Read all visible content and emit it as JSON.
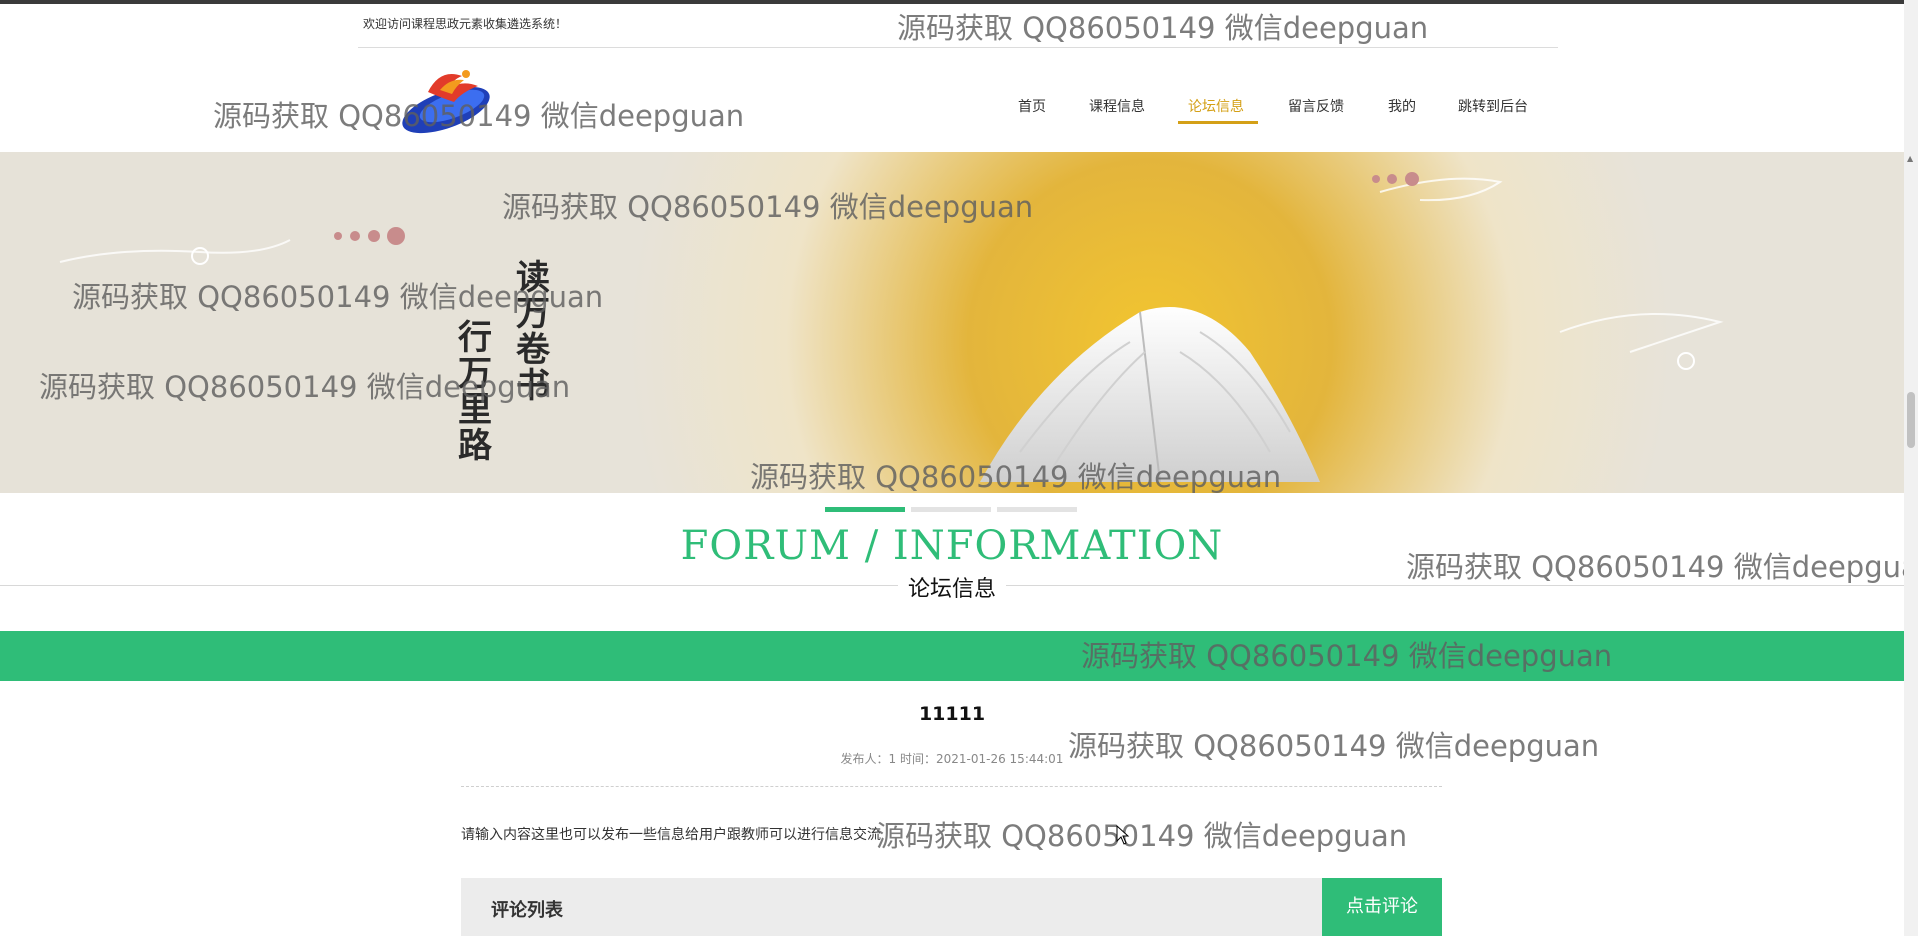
{
  "header": {
    "welcome_text": "欢迎访问课程思政元素收集遴选系统！"
  },
  "nav": {
    "items": [
      {
        "label": "首页",
        "active": false
      },
      {
        "label": "课程信息",
        "active": false
      },
      {
        "label": "论坛信息",
        "active": true
      },
      {
        "label": "留言反馈",
        "active": false
      },
      {
        "label": "我的",
        "active": false
      },
      {
        "label": "跳转到后台",
        "active": false
      }
    ]
  },
  "banner": {
    "calligraphy_right": "读万卷书",
    "calligraphy_left": "行万里路",
    "slide_count": 3,
    "active_slide": 1
  },
  "section": {
    "title_en": "FORUM / INFORMATION",
    "title_cn": "论坛信息"
  },
  "article": {
    "title": "11111",
    "meta": "发布人：1 时间：2021-01-26 15:44:01",
    "content": "请输入内容这里也可以发布一些信息给用户跟教师可以进行信息交流"
  },
  "comments": {
    "header": "评论列表",
    "button_label": "点击评论"
  },
  "watermark": "源码获取 QQ86050149 微信deepguan",
  "colors": {
    "accent_green": "#2fbd78",
    "active_nav": "#d4a017"
  }
}
